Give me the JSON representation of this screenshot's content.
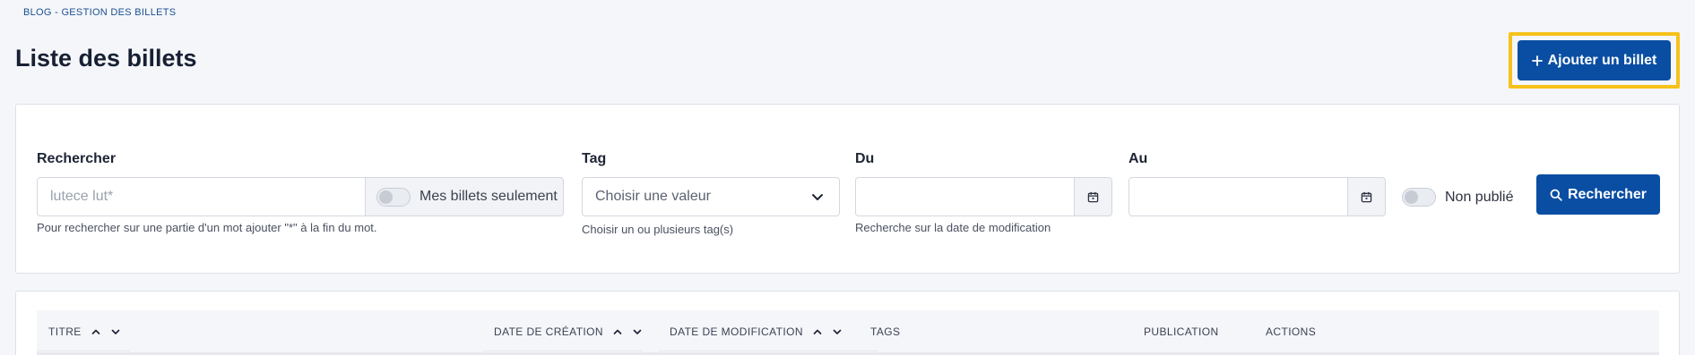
{
  "breadcrumb": "BLOG - GESTION DES BILLETS",
  "page_title": "Liste des billets",
  "add_button": {
    "icon": "plus-icon",
    "label": "Ajouter un billet"
  },
  "colors": {
    "primary": "#0a4ea3",
    "highlight": "#f6c21a",
    "background": "#f5f6fa"
  },
  "filters": {
    "search": {
      "label": "Rechercher",
      "placeholder": "lutece lut*",
      "mine_only_label": "Mes billets seulement",
      "help": "Pour rechercher sur une partie d'un mot ajouter \"*\" à la fin du mot."
    },
    "tag": {
      "label": "Tag",
      "selected": "Choisir une valeur",
      "help": "Choisir un ou plusieurs tag(s)"
    },
    "from": {
      "label": "Du",
      "help": "Recherche sur la date de modification"
    },
    "to": {
      "label": "Au"
    },
    "unpublished_label": "Non publié",
    "search_button": {
      "icon": "search-icon",
      "label": "Rechercher"
    }
  },
  "table": {
    "columns": [
      {
        "label": "TITRE",
        "sortable": true
      },
      {
        "label": "DATE DE CRÉATION",
        "sortable": true
      },
      {
        "label": "DATE DE MODIFICATION",
        "sortable": true
      },
      {
        "label": "TAGS",
        "sortable": false
      },
      {
        "label": "PUBLICATION",
        "sortable": false
      },
      {
        "label": "ACTIONS",
        "sortable": false
      }
    ]
  }
}
